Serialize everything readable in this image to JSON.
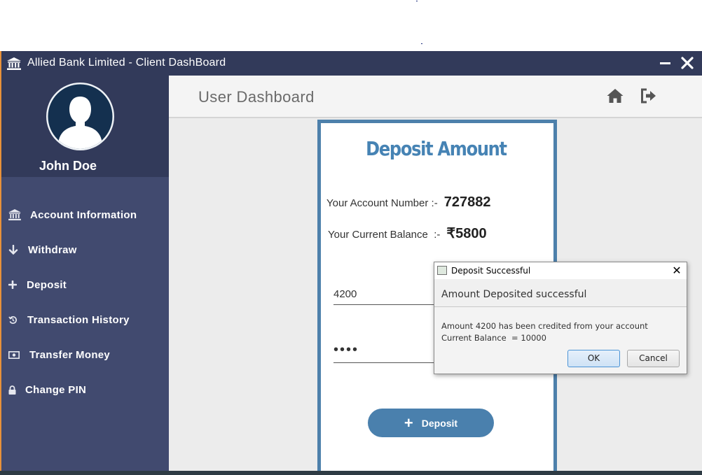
{
  "window": {
    "title": "Allied Bank Limited - Client DashBoard",
    "minimize_label": "▬",
    "close_label": "✕"
  },
  "sidebar": {
    "user_name": "John Doe",
    "items": [
      {
        "label": "Account Information",
        "icon": "bank-icon"
      },
      {
        "label": "Withdraw",
        "icon": "arrow-down-icon"
      },
      {
        "label": "Deposit",
        "icon": "plus-icon"
      },
      {
        "label": "Transaction History",
        "icon": "history-icon"
      },
      {
        "label": "Transfer Money",
        "icon": "money-icon"
      },
      {
        "label": "Change PIN",
        "icon": "lock-icon"
      }
    ]
  },
  "header": {
    "title": "User Dashboard",
    "home_icon": "home-icon",
    "logout_icon": "logout-icon"
  },
  "deposit_form": {
    "title": "Deposit Amount",
    "account_label": "Your Account Number :-",
    "account_number": "727882",
    "balance_label": "Your Current Balance  :-",
    "balance_value": "₹5800",
    "amount_value": "4200",
    "pin_value": "••••",
    "button_label": "Deposit",
    "button_icon": "+"
  },
  "dialog": {
    "title": "Deposit Successful",
    "header": "Amount Deposited successful",
    "line1": "Amount 4200 has been credited from your account",
    "line2": "Current Balance  = 10000",
    "ok_label": "OK",
    "cancel_label": "Cancel",
    "close_label": "✕"
  },
  "colors": {
    "titlebar": "#323a5a",
    "sidebar": "#414a6f",
    "accent": "#4a80ad"
  }
}
